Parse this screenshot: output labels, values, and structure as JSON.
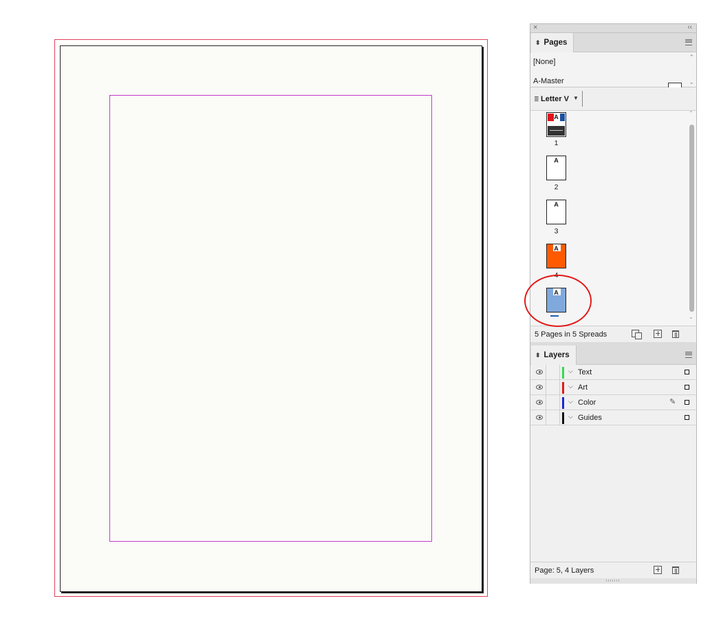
{
  "pages_panel": {
    "close_glyph": "×",
    "collapse_glyph": "‹‹",
    "tab_label": "Pages",
    "tab_arrows": "⬍",
    "masters": [
      {
        "label": "[None]"
      },
      {
        "label": "A-Master"
      }
    ],
    "size_label": "Letter V",
    "pages": [
      {
        "number": "1",
        "prefix": "A",
        "style": "cover"
      },
      {
        "number": "2",
        "prefix": "A",
        "style": "blank"
      },
      {
        "number": "3",
        "prefix": "A",
        "style": "blank"
      },
      {
        "number": "4",
        "prefix": "A",
        "style": "orange"
      },
      {
        "number": "",
        "prefix": "A",
        "style": "blue",
        "selected": true
      }
    ],
    "status": "5 Pages in 5 Spreads"
  },
  "layers_panel": {
    "tab_label": "Layers",
    "layers": [
      {
        "name": "Text",
        "color": "#35d94a"
      },
      {
        "name": "Art",
        "color": "#e21a1a"
      },
      {
        "name": "Color",
        "color": "#1f23d6",
        "active": true
      },
      {
        "name": "Guides",
        "color": "#111111"
      }
    ],
    "status": "Page: 5, 4 Layers"
  },
  "colors": {
    "bleed": "#e2405d",
    "margin": "#c13ad0",
    "callout": "#e21a1a",
    "page4": "#ff5a00",
    "page5": "#7fa9dd"
  }
}
